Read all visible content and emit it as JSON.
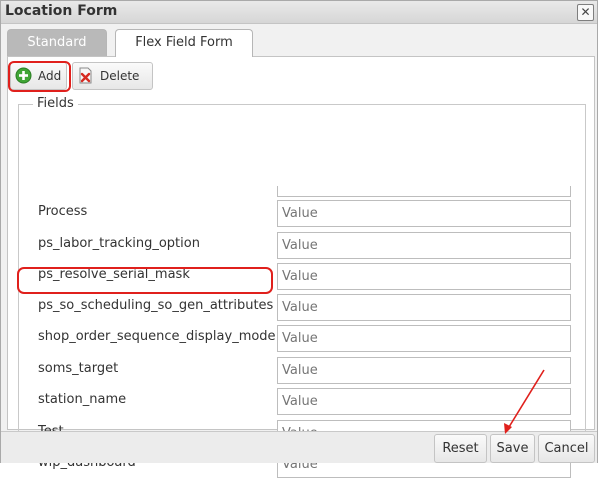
{
  "window": {
    "title": "Location Form",
    "close_icon": "close-icon"
  },
  "tabs": [
    {
      "label": "Standard",
      "active": false
    },
    {
      "label": "Flex Field Form",
      "active": true
    }
  ],
  "toolbar": {
    "add_label": "Add",
    "add_icon": "plus-circle-icon",
    "delete_label": "Delete",
    "delete_icon": "delete-page-icon"
  },
  "fields_section": {
    "legend": "Fields",
    "rows": [
      {
        "label": "Process",
        "placeholder": "Value"
      },
      {
        "label": "ps_labor_tracking_option",
        "placeholder": "Value"
      },
      {
        "label": "ps_resolve_serial_mask",
        "placeholder": "Value"
      },
      {
        "label": "ps_so_scheduling_so_gen_attributes",
        "placeholder": "Value"
      },
      {
        "label": "shop_order_sequence_display_mode",
        "placeholder": "Value"
      },
      {
        "label": "soms_target",
        "placeholder": "Value"
      },
      {
        "label": "station_name",
        "placeholder": "Value"
      },
      {
        "label": "Test",
        "placeholder": "Value"
      },
      {
        "label": "wip_dashboard",
        "placeholder": "Value"
      }
    ]
  },
  "footer": {
    "reset_label": "Reset",
    "save_label": "Save",
    "cancel_label": "Cancel"
  },
  "colors": {
    "annotation_red": "#e0201c",
    "add_icon_green": "#3fa535",
    "delete_icon_red": "#d62a21"
  }
}
